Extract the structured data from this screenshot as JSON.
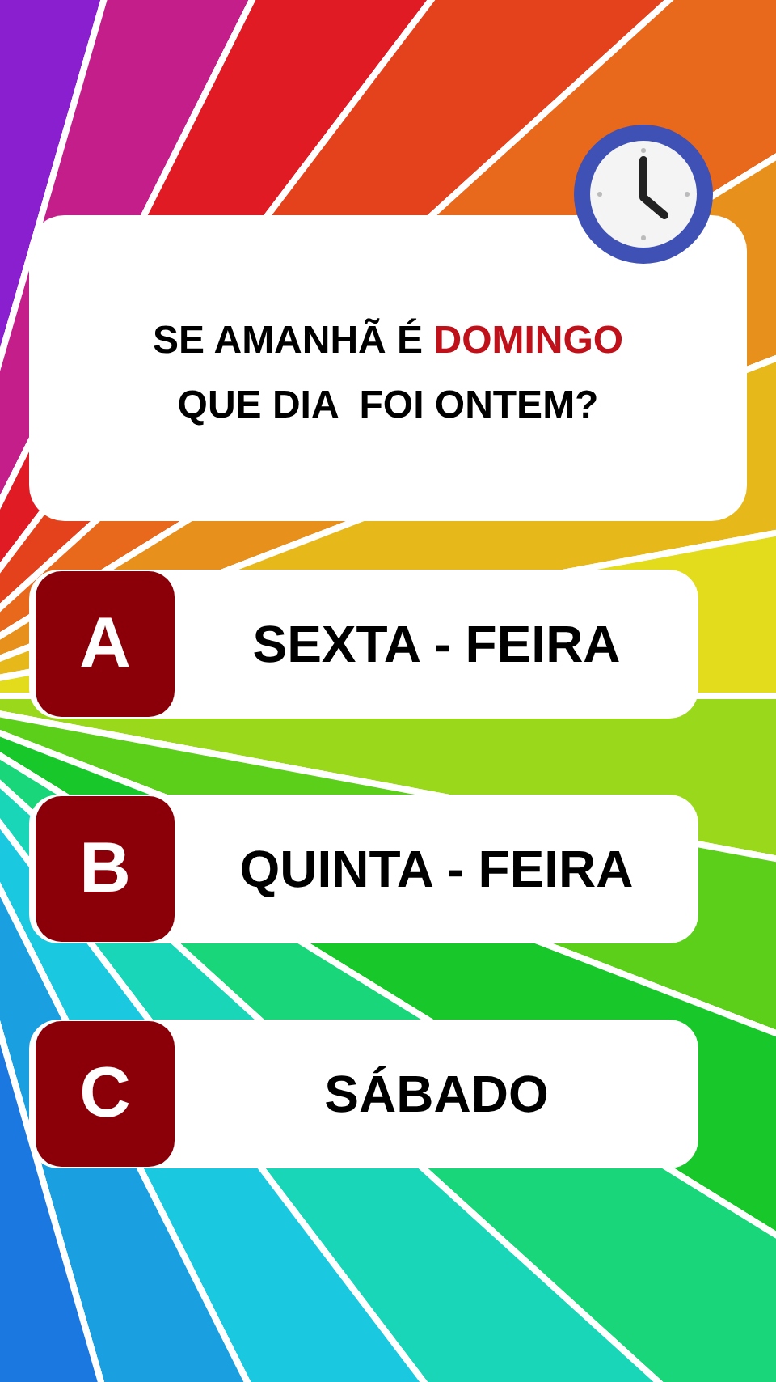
{
  "question": "SE AMANHÃ É **DOMINGO**\nQUE DIA  FOI ONTEM?",
  "options": [
    {
      "letter": "A",
      "text": "SEXTA - FEIRA"
    },
    {
      "letter": "B",
      "text": "QUINTA - FEIRA"
    },
    {
      "letter": "C",
      "text": "SÁBADO"
    }
  ]
}
